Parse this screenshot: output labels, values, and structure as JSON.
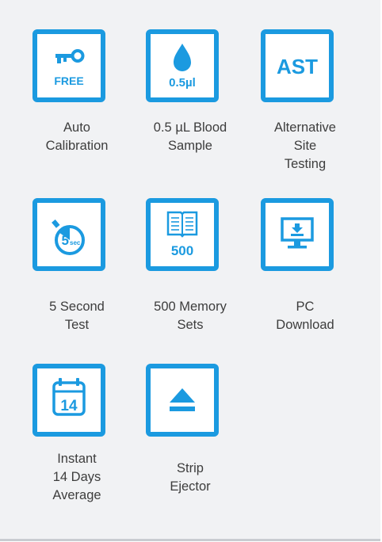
{
  "accent_color": "#1b9ae0",
  "features": [
    {
      "icon": "key-icon",
      "badge": "FREE",
      "label": "Auto\nCalibration"
    },
    {
      "icon": "blood-drop-icon",
      "badge": "0.5µl",
      "label": "0.5 µL Blood\nSample"
    },
    {
      "icon": "ast-icon",
      "badge": "AST",
      "label": "Alternative\nSite\nTesting"
    },
    {
      "icon": "stopwatch-icon",
      "badge": "5",
      "badge_sub": "sec",
      "label": "5 Second\nTest"
    },
    {
      "icon": "book-icon",
      "badge": "500",
      "label": "500 Memory\nSets"
    },
    {
      "icon": "monitor-download-icon",
      "label": "PC\nDownload"
    },
    {
      "icon": "calendar-icon",
      "badge": "14",
      "label": "Instant\n14 Days\nAverage"
    },
    {
      "icon": "eject-icon",
      "label": "Strip\nEjector"
    }
  ]
}
